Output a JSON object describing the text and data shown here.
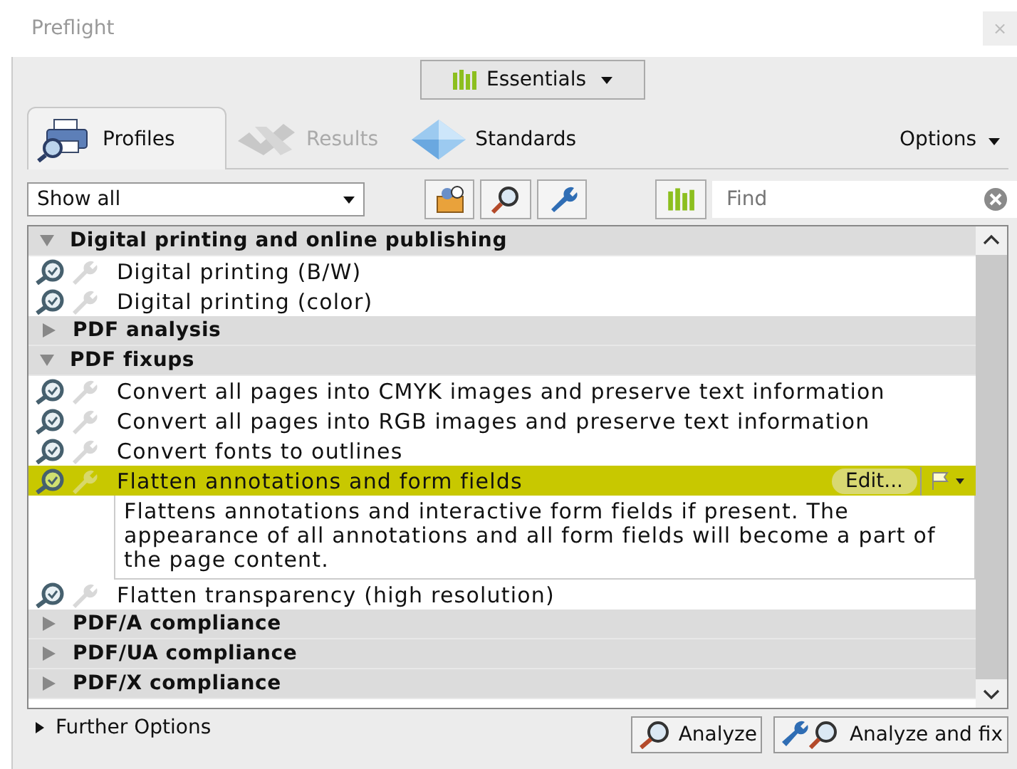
{
  "window": {
    "title": "Preflight",
    "close": "×"
  },
  "workspace": {
    "label": "Essentials"
  },
  "tabs": [
    {
      "label": "Profiles",
      "selected": true,
      "disabled": false
    },
    {
      "label": "Results",
      "selected": false,
      "disabled": true
    },
    {
      "label": "Standards",
      "selected": false,
      "disabled": false
    }
  ],
  "options": {
    "label": "Options"
  },
  "filter": {
    "value": "Show all"
  },
  "find": {
    "placeholder": "Find"
  },
  "groups": [
    {
      "label": "Digital printing and online publishing",
      "expanded": true,
      "children": [
        {
          "label": "Digital printing (B/W)",
          "selected": false
        },
        {
          "label": "Digital printing (color)",
          "selected": false
        }
      ]
    },
    {
      "label": "PDF analysis",
      "expanded": false
    },
    {
      "label": "PDF fixups",
      "expanded": true,
      "children": [
        {
          "label": "Convert all pages into CMYK images and preserve text information",
          "selected": false
        },
        {
          "label": "Convert all pages into RGB images and preserve text information",
          "selected": false
        },
        {
          "label": "Convert fonts to outlines",
          "selected": false
        },
        {
          "label": "Flatten annotations and form fields",
          "selected": true,
          "edit": "Edit...",
          "description": "Flattens annotations and interactive form fields if present. The appearance of all annotations and all form fields will become a part of the page content."
        },
        {
          "label": "Flatten transparency (high resolution)",
          "selected": false
        }
      ]
    },
    {
      "label": "PDF/A compliance",
      "expanded": false
    },
    {
      "label": "PDF/UA compliance",
      "expanded": false
    },
    {
      "label": "PDF/X compliance",
      "expanded": false
    }
  ],
  "further_options": {
    "label": "Further Options",
    "expanded": false
  },
  "buttons": [
    {
      "label": "Analyze",
      "kind": "analyze"
    },
    {
      "label": "Analyze and fix",
      "kind": "fix"
    }
  ]
}
